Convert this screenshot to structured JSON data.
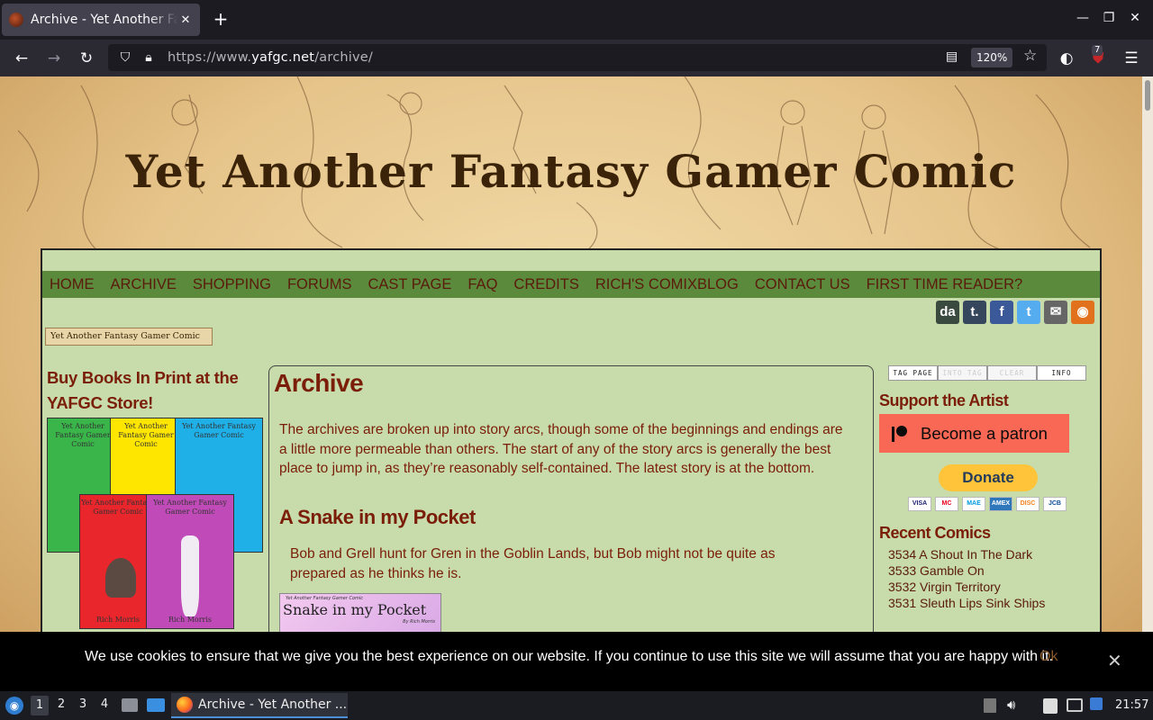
{
  "browser": {
    "tab_title": "Archive - Yet Another Fantasy Gamer Comic",
    "new_tab_icon": "plus-icon",
    "url_prefix": "https://www.",
    "url_domain": "yafgc.net",
    "url_path": "/archive/",
    "zoom": "120%",
    "extension_badge": "7"
  },
  "site": {
    "banner_title": "Yet Another Fantasy Gamer Comic",
    "small_banner": "Yet Another Fantasy Gamer Comic",
    "menu": [
      "HOME",
      "ARCHIVE",
      "SHOPPING",
      "FORUMS",
      "CAST PAGE",
      "FAQ",
      "CREDITS",
      "RICH'S COMIXBLOG",
      "CONTACT US",
      "FIRST TIME READER?"
    ],
    "social": [
      {
        "icon": "deviantart-icon",
        "glyph": "da",
        "color": "#3b4a3f"
      },
      {
        "icon": "tumblr-icon",
        "glyph": "t.",
        "color": "#36465d"
      },
      {
        "icon": "facebook-icon",
        "glyph": "f",
        "color": "#3b5998"
      },
      {
        "icon": "twitter-icon",
        "glyph": "t",
        "color": "#55acee"
      },
      {
        "icon": "email-icon",
        "glyph": "✉",
        "color": "#666666"
      },
      {
        "icon": "rss-icon",
        "glyph": "◉",
        "color": "#e2711d"
      }
    ]
  },
  "left": {
    "store_heading": "Buy Books In Print at the YAFGC Store!",
    "book_title": "Yet Another Fantasy Gamer Comic",
    "book_author": "Rich Morris"
  },
  "main": {
    "heading": "Archive",
    "intro": "The archives are broken up into story arcs, though some of the beginnings and endings are a little more permeable than others. The start of any of the story arcs is generally the best place to jump in, as they’re reasonably self-contained. The latest story is at the bottom.",
    "arc_title": "A Snake in my Pocket",
    "arc_desc": "Bob and Grell hunt for Gren in the Goblin Lands, but Bob might not be quite as prepared as he thinks he is.",
    "arc_thumb_small": "Yet Another Fantasy Gamer Comic",
    "arc_thumb_title": "Snake in my Pocket",
    "arc_thumb_by": "By Rich Morris"
  },
  "right": {
    "tag_buttons": [
      "TAG PAGE",
      "INTO TAG",
      "CLEAR",
      "INFO"
    ],
    "support_heading": "Support the Artist",
    "patron_label": "Become a patron",
    "donate_label": "Donate",
    "cards": [
      "VISA",
      "MC",
      "MAE",
      "AMEX",
      "DISC",
      "JCB"
    ],
    "recent_heading": "Recent Comics",
    "recent": [
      "3534 A Shout In The Dark",
      "3533 Gamble On",
      "3532 Virgin Territory",
      "3531 Sleuth Lips Sink Ships"
    ]
  },
  "cookie": {
    "text": "We use cookies to ensure that we give you the best experience on our website. If you continue to use this site we will assume that you are happy with it.",
    "ok": "Ok"
  },
  "taskbar": {
    "workspaces": [
      "1",
      "2",
      "3",
      "4"
    ],
    "task_label": "Archive - Yet Another ...",
    "clock": "21:57"
  }
}
